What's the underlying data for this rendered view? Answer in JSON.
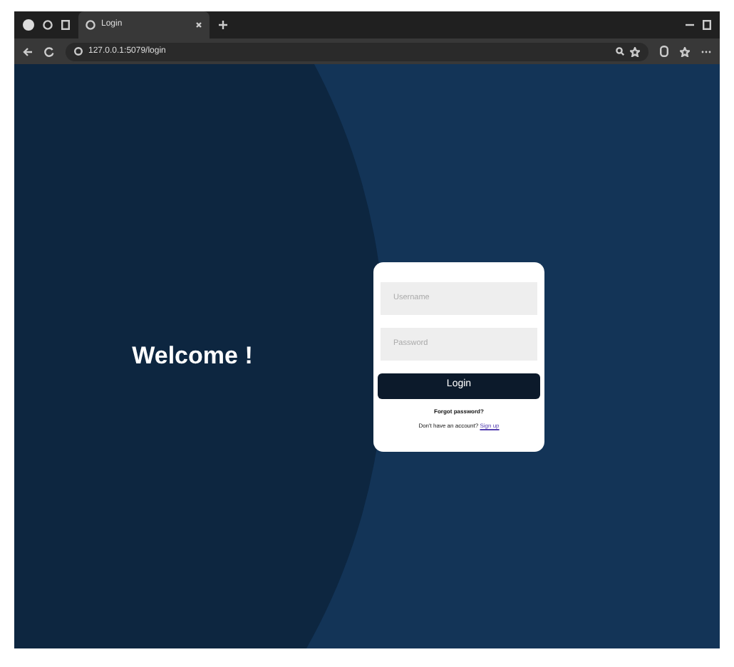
{
  "browser": {
    "tab_title": "Login",
    "url": "127.0.0.1:5079/login"
  },
  "page": {
    "heading": "Welcome !"
  },
  "login_form": {
    "username": {
      "placeholder": "Username"
    },
    "password": {
      "placeholder": "Password"
    },
    "submit": "Login",
    "forgot": "Forgot password?",
    "signup_prompt": "Don't have an account?",
    "signup_link": "Sign up"
  }
}
